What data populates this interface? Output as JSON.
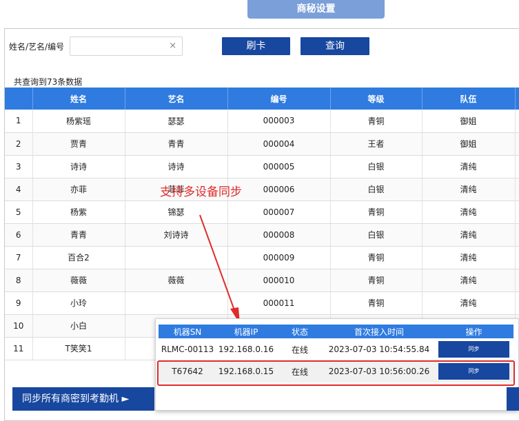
{
  "top_tab": "商秘设置",
  "search": {
    "label": "姓名/艺名/编号",
    "value": "",
    "placeholder": "",
    "clear_icon": "×",
    "swipe_button": "刷卡",
    "query_button": "查询"
  },
  "result_count": "共查询到73条数据",
  "table": {
    "headers": [
      "",
      "姓名",
      "艺名",
      "编号",
      "等级",
      "队伍"
    ],
    "rows": [
      [
        "1",
        "杨紫瑶",
        "瑟瑟",
        "000003",
        "青铜",
        "御姐"
      ],
      [
        "2",
        "贾青",
        "青青",
        "000004",
        "王者",
        "御姐"
      ],
      [
        "3",
        "诗诗",
        "诗诗",
        "000005",
        "白银",
        "清纯"
      ],
      [
        "4",
        "亦菲",
        "菲菲",
        "000006",
        "白银",
        "清纯"
      ],
      [
        "5",
        "杨紫",
        "锦瑟",
        "000007",
        "青铜",
        "清纯"
      ],
      [
        "6",
        "青青",
        "刘诗诗",
        "000008",
        "白银",
        "清纯"
      ],
      [
        "7",
        "百合2",
        "",
        "000009",
        "青铜",
        "清纯"
      ],
      [
        "8",
        "薇薇",
        "薇薇",
        "000010",
        "青铜",
        "清纯"
      ],
      [
        "9",
        "小玲",
        "",
        "000011",
        "青铜",
        "清纯"
      ],
      [
        "10",
        "小白",
        "",
        "",
        "",
        ""
      ],
      [
        "11",
        "T笑笑1",
        "",
        "",
        "",
        ""
      ]
    ]
  },
  "annotation": "支持多设备同步",
  "device_popup": {
    "headers": [
      "机器SN",
      "机器IP",
      "状态",
      "首次接入时间",
      "操作"
    ],
    "rows": [
      {
        "sn": "RLMC-00113",
        "ip": "192.168.0.16",
        "status": "在线",
        "time": "2023-07-03 10:54:55.84",
        "action": "同步"
      },
      {
        "sn": "T67642",
        "ip": "192.168.0.15",
        "status": "在线",
        "time": "2023-07-03 10:56:00.26",
        "action": "同步"
      }
    ]
  },
  "sync_all_button": "同步所有商密到考勤机 ►",
  "colors": {
    "primary": "#17479f",
    "header": "#2f7be0",
    "tab": "#7b9fd9",
    "annotation": "#e02b2b"
  }
}
